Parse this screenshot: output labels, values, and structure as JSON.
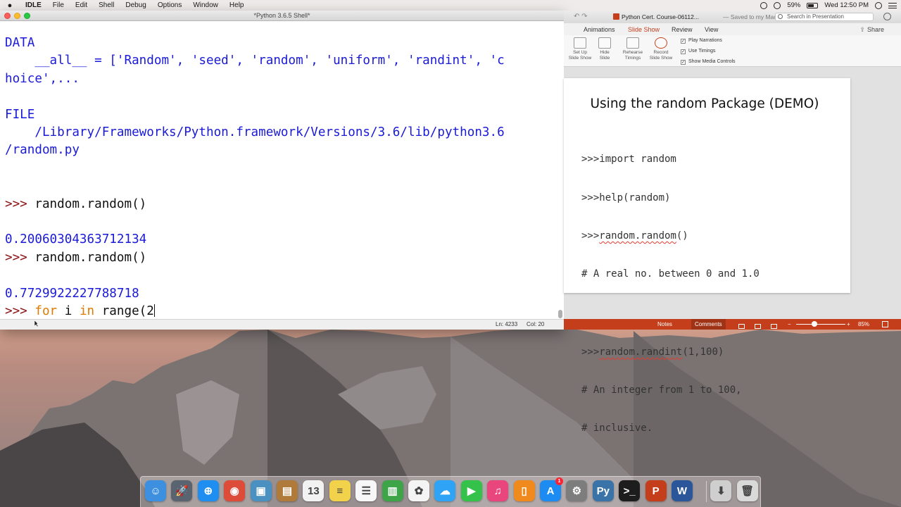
{
  "menubar": {
    "app": "IDLE",
    "items": [
      "File",
      "Edit",
      "Shell",
      "Debug",
      "Options",
      "Window",
      "Help"
    ],
    "battery": "59%",
    "clock": "Wed 12:50 PM"
  },
  "idle": {
    "title": "*Python 3.6.5 Shell*",
    "lines": {
      "l1": "DATA",
      "l2": "    __all__ = ['Random', 'seed', 'random', 'uniform', 'randint', 'c",
      "l3": "hoice',...",
      "l4": "FILE",
      "l5": "    /Library/Frameworks/Python.framework/Versions/3.6/lib/python3.6",
      "l6": "/random.py",
      "prompt": ">>> ",
      "cmd1": "random.random()",
      "out1": "0.20060304363712134",
      "cmd2": "random.random()",
      "out2": "0.7729922227788718",
      "kw_for": "for",
      "cmd3a": " i ",
      "kw_in": "in",
      "cmd3b": " range(2"
    },
    "status": {
      "ln": "Ln: 4233",
      "col": "Col: 20"
    }
  },
  "ppt": {
    "doc_title": "Python Cert. Course-06112...",
    "saved": "— Saved to my Mac",
    "search_placeholder": "Search in Presentation",
    "tabs": [
      "Animations",
      "Slide Show",
      "Review",
      "View"
    ],
    "active_tab": "Slide Show",
    "share": "Share",
    "ribbon_buttons": [
      {
        "l1": "Set Up",
        "l2": "Slide Show"
      },
      {
        "l1": "Hide",
        "l2": "Slide"
      },
      {
        "l1": "Rehearse",
        "l2": "Timings"
      },
      {
        "l1": "Record",
        "l2": "Slide Show"
      }
    ],
    "checkboxes": [
      "Play Narrations",
      "Use Timings",
      "Show Media Controls"
    ],
    "slide": {
      "title": "Using the random Package (DEMO)",
      "c1": ">>>import random",
      "c2": ">>>help(random)",
      "c3_prefix": ">>>",
      "c3_call": "random.random",
      "c3_suffix": "()",
      "c4": "# A real no. between 0 and 1.0",
      "c5_prefix": ">>>",
      "c5_call": "random.randint",
      "c5_suffix": "(1,100)",
      "c6": "# An integer from 1 to 100,",
      "c7": "# inclusive."
    },
    "status": {
      "notes": "Notes",
      "comments": "Comments",
      "zoom": "85%",
      "minus": "−",
      "plus": "+"
    }
  },
  "dock": {
    "apps": [
      {
        "name": "Finder",
        "glyph": "☺",
        "color": "#3d8fe0"
      },
      {
        "name": "Launchpad",
        "glyph": "🚀",
        "color": "#5a6470"
      },
      {
        "name": "Safari",
        "glyph": "⊕",
        "color": "#1e8ff0"
      },
      {
        "name": "Chrome",
        "glyph": "◉",
        "color": "#dd4b39"
      },
      {
        "name": "Preview",
        "glyph": "▣",
        "color": "#4a90c0"
      },
      {
        "name": "Notebook",
        "glyph": "▤",
        "color": "#b07a3a"
      },
      {
        "name": "Calendar",
        "glyph": "13",
        "color": "#f2f2f2"
      },
      {
        "name": "Notes",
        "glyph": "≡",
        "color": "#f1d24a"
      },
      {
        "name": "Reminders",
        "glyph": "☰",
        "color": "#f7f7f7"
      },
      {
        "name": "Numbers",
        "glyph": "▥",
        "color": "#3da548"
      },
      {
        "name": "Photos",
        "glyph": "✿",
        "color": "#f4f4f4"
      },
      {
        "name": "Messages",
        "glyph": "☁",
        "color": "#2fa3f5"
      },
      {
        "name": "FaceTime",
        "glyph": "▶",
        "color": "#34c24a"
      },
      {
        "name": "iTunes",
        "glyph": "♫",
        "color": "#e8467c"
      },
      {
        "name": "iBooks",
        "glyph": "▯",
        "color": "#f18a1c"
      },
      {
        "name": "App Store",
        "glyph": "A",
        "color": "#1d8cf2",
        "badge": "1"
      },
      {
        "name": "System Preferences",
        "glyph": "⚙",
        "color": "#7d7d7d"
      },
      {
        "name": "Python",
        "glyph": "Py",
        "color": "#3a73a8"
      },
      {
        "name": "Terminal",
        "glyph": ">_",
        "color": "#1d1d1d"
      },
      {
        "name": "PowerPoint",
        "glyph": "P",
        "color": "#c43e1c"
      },
      {
        "name": "Word",
        "glyph": "W",
        "color": "#2b579a"
      },
      {
        "name": "Downloads",
        "glyph": "⬇",
        "color": "#cfcfcf"
      },
      {
        "name": "Trash",
        "glyph": "🗑",
        "color": "#d9d9d9"
      }
    ]
  }
}
